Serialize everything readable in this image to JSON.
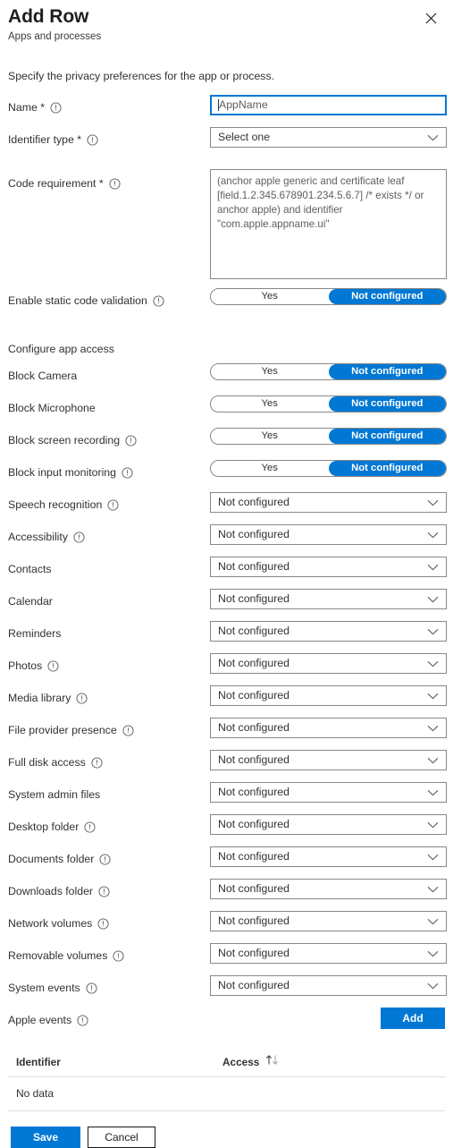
{
  "header": {
    "title": "Add Row",
    "subtitle": "Apps and processes",
    "close_icon": "close-icon"
  },
  "intro": "Specify the privacy preferences for the app or process.",
  "fields": {
    "name": {
      "label": "Name",
      "required_mark": "*",
      "value": "AppName",
      "has_info": true
    },
    "identifier_type": {
      "label": "Identifier type",
      "required_mark": "*",
      "value": "Select one",
      "has_info": true
    },
    "code_requirement": {
      "label": "Code requirement",
      "required_mark": "*",
      "value": "(anchor apple generic and certificate leaf [field.1.2.345.678901.234.5.6.7] /* exists */ or anchor apple) and identifier \"com.apple.appname.ui\"",
      "has_info": true
    },
    "static_code_validation": {
      "label": "Enable static code validation",
      "has_info": true,
      "options": [
        "Yes",
        "Not configured"
      ],
      "selected": "Not configured"
    }
  },
  "section": {
    "heading": "Configure app access"
  },
  "toggle_rows": [
    {
      "label": "Block Camera",
      "has_info": false,
      "options": [
        "Yes",
        "Not configured"
      ],
      "selected": "Not configured"
    },
    {
      "label": "Block Microphone",
      "has_info": false,
      "options": [
        "Yes",
        "Not configured"
      ],
      "selected": "Not configured"
    },
    {
      "label": "Block screen recording",
      "has_info": true,
      "options": [
        "Yes",
        "Not configured"
      ],
      "selected": "Not configured"
    },
    {
      "label": "Block input monitoring",
      "has_info": true,
      "options": [
        "Yes",
        "Not configured"
      ],
      "selected": "Not configured"
    }
  ],
  "select_rows": [
    {
      "label": "Speech recognition",
      "has_info": true,
      "value": "Not configured"
    },
    {
      "label": "Accessibility",
      "has_info": true,
      "value": "Not configured"
    },
    {
      "label": "Contacts",
      "has_info": false,
      "value": "Not configured"
    },
    {
      "label": "Calendar",
      "has_info": false,
      "value": "Not configured"
    },
    {
      "label": "Reminders",
      "has_info": false,
      "value": "Not configured"
    },
    {
      "label": "Photos",
      "has_info": true,
      "value": "Not configured"
    },
    {
      "label": "Media library",
      "has_info": true,
      "value": "Not configured"
    },
    {
      "label": "File provider presence",
      "has_info": true,
      "value": "Not configured"
    },
    {
      "label": "Full disk access",
      "has_info": true,
      "value": "Not configured"
    },
    {
      "label": "System admin files",
      "has_info": false,
      "value": "Not configured"
    },
    {
      "label": "Desktop folder",
      "has_info": true,
      "value": "Not configured"
    },
    {
      "label": "Documents folder",
      "has_info": true,
      "value": "Not configured"
    },
    {
      "label": "Downloads folder",
      "has_info": true,
      "value": "Not configured"
    },
    {
      "label": "Network volumes",
      "has_info": true,
      "value": "Not configured"
    },
    {
      "label": "Removable volumes",
      "has_info": true,
      "value": "Not configured"
    },
    {
      "label": "System events",
      "has_info": true,
      "value": "Not configured"
    }
  ],
  "apple_events": {
    "label": "Apple events",
    "has_info": true,
    "add_label": "Add"
  },
  "table": {
    "columns": [
      "Identifier",
      "Access"
    ],
    "sort_icon": "sort-ascending-descending-icon",
    "empty_text": "No data"
  },
  "footer": {
    "save_label": "Save",
    "cancel_label": "Cancel"
  },
  "colors": {
    "accent": "#0078d4",
    "border": "#8a8886",
    "text": "#323130",
    "muted": "#605e5c",
    "divider": "#e1dfdd"
  }
}
